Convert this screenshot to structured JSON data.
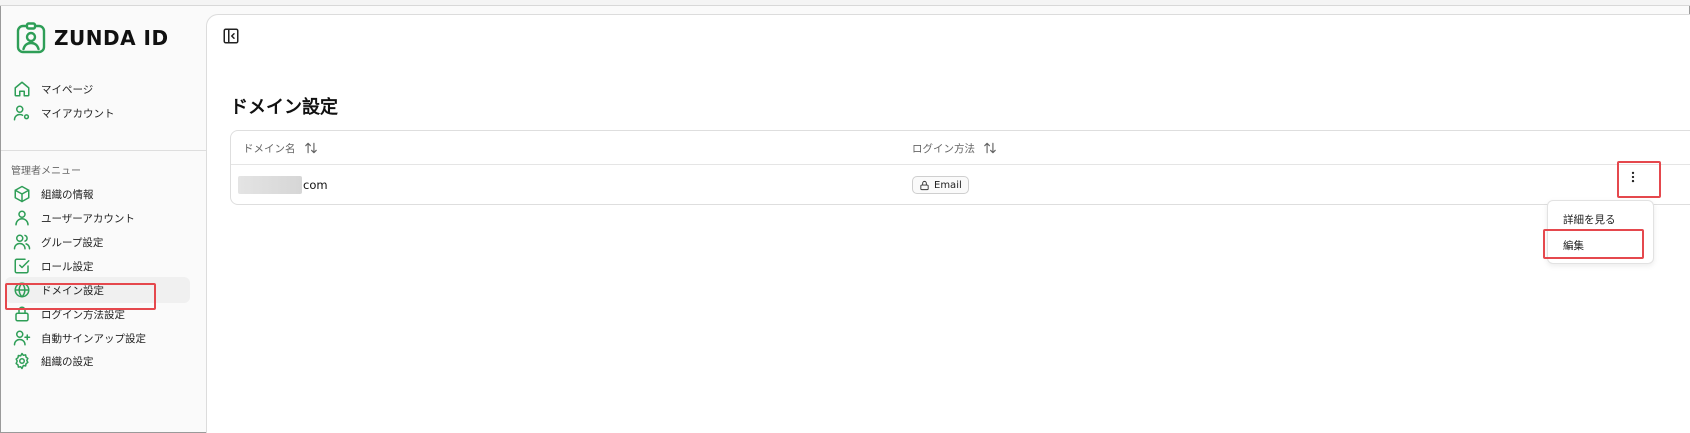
{
  "app": {
    "name": "ZUNDA ID"
  },
  "sidebar": {
    "user_items": [
      {
        "label": "マイページ",
        "icon": "home-icon"
      },
      {
        "label": "マイアカウント",
        "icon": "user-settings-icon"
      }
    ],
    "admin_section_label": "管理者メニュー",
    "admin_items": [
      {
        "label": "組織の情報",
        "icon": "box-icon"
      },
      {
        "label": "ユーザーアカウント",
        "icon": "user-icon"
      },
      {
        "label": "グループ設定",
        "icon": "users-icon"
      },
      {
        "label": "ロール設定",
        "icon": "check-square-icon"
      },
      {
        "label": "ドメイン設定",
        "icon": "globe-icon",
        "active": true
      },
      {
        "label": "ログイン方法設定",
        "icon": "lock-icon"
      },
      {
        "label": "自動サインアップ設定",
        "icon": "user-plus-icon"
      },
      {
        "label": "組織の設定",
        "icon": "gear-icon"
      }
    ]
  },
  "main": {
    "title": "ドメイン設定",
    "table": {
      "columns": [
        {
          "label": "ドメイン名"
        },
        {
          "label": "ログイン方法"
        }
      ],
      "rows": [
        {
          "domain_suffix": "com",
          "login_method": "Email"
        }
      ]
    },
    "row_menu": {
      "items": [
        {
          "label": "詳細を見る"
        },
        {
          "label": "編集"
        }
      ]
    }
  },
  "colors": {
    "accent": "#2e9e57",
    "highlight": "#e5484d"
  }
}
